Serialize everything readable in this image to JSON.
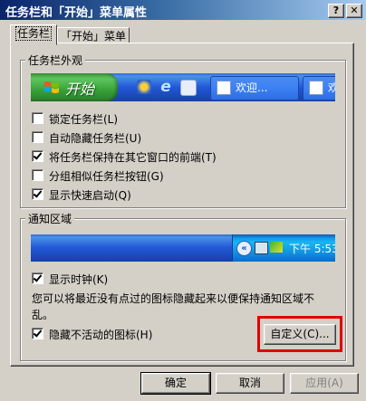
{
  "window": {
    "title": "任务栏和「开始」菜单属性",
    "help_label": "?",
    "close_label": "✕"
  },
  "tabs": [
    {
      "label": "任务栏",
      "active": true
    },
    {
      "label": "「开始」菜单",
      "active": false
    }
  ],
  "appearance": {
    "legend": "任务栏外观",
    "start_label": "开始",
    "task_items": [
      "欢迎...",
      "欢"
    ],
    "options": [
      {
        "label": "锁定任务栏(L)",
        "checked": false
      },
      {
        "label": "自动隐藏任务栏(U)",
        "checked": false
      },
      {
        "label": "将任务栏保持在其它窗口的前端(T)",
        "checked": true
      },
      {
        "label": "分组相似任务栏按钮(G)",
        "checked": false
      },
      {
        "label": "显示快速启动(Q)",
        "checked": true
      }
    ]
  },
  "notification": {
    "legend": "通知区域",
    "clock": "下午 5:53",
    "show_clock": {
      "label": "显示时钟(K)",
      "checked": true
    },
    "description": "您可以将最近没有点过的图标隐藏起来以便保持通知区域不乱。",
    "hide_inactive": {
      "label": "隐藏不活动的图标(H)",
      "checked": true
    },
    "customize_label": "自定义(C)..."
  },
  "footer": {
    "ok_label": "确定",
    "cancel_label": "取消",
    "apply_label": "应用(A)"
  },
  "colors": {
    "highlight": "#e00000",
    "title_bar": "#0a246a"
  }
}
